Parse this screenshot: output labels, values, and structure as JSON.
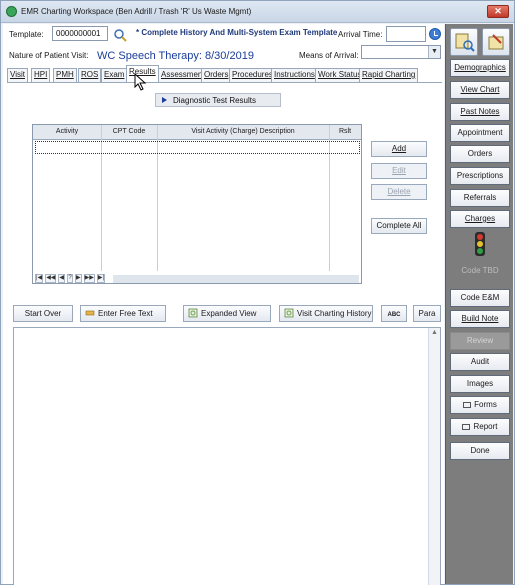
{
  "window": {
    "title": "EMR Charting Workspace (Ben Adrill / Trash 'R' Us Waste Mgmt)",
    "close_glyph": "✕"
  },
  "header": {
    "template_label": "Template:",
    "template_value": "0000000001",
    "template_name": "* Complete History And Multi-System Exam Template",
    "arrival_time_label": "Arrival Time:",
    "arrival_time_value": "",
    "nature_label": "Nature of Patient Visit:",
    "nature_value": "WC Speech Therapy: 8/30/2019",
    "means_label": "Means of Arrival:",
    "means_value": ""
  },
  "tabs": [
    {
      "label": "Visit"
    },
    {
      "label": "HPI"
    },
    {
      "label": "PMH"
    },
    {
      "label": "ROS"
    },
    {
      "label": "Exam"
    },
    {
      "label": "Results"
    },
    {
      "label": "Assessment"
    },
    {
      "label": "Orders"
    },
    {
      "label": "Procedures"
    },
    {
      "label": "Instructions"
    },
    {
      "label": "Work Status"
    },
    {
      "label": "Rapid Charting"
    }
  ],
  "active_tab": "Results",
  "diagnostic": {
    "label": "Diagnostic Test Results"
  },
  "grid": {
    "columns": [
      "Activity",
      "CPT Code",
      "Visit Activity (Charge) Description",
      "Rslt"
    ],
    "nav": [
      "|◀",
      "◀◀",
      "◀",
      "?",
      "▶",
      "▶▶",
      "▶|"
    ]
  },
  "grid_actions": {
    "add": "Add",
    "edit": "Edit",
    "delete": "Delete",
    "complete_all": "Complete All"
  },
  "toolbar": {
    "start_over": "Start Over",
    "free_text": "Enter Free Text",
    "expanded_view": "Expanded View",
    "charting_history": "Visit Charting History",
    "spell_icon_text": "ABC",
    "para": "Para"
  },
  "right_panel": {
    "demographics": "Demographics",
    "view_chart": "View Chart",
    "past_notes": "Past Notes",
    "appointment": "Appointment",
    "orders": "Orders",
    "prescriptions": "Prescriptions",
    "referrals": "Referrals",
    "charges": "Charges",
    "code_tbd": "Code TBD",
    "code_em": "Code E&M",
    "build_note": "Build Note",
    "review": "Review",
    "audit": "Audit",
    "images": "Images",
    "forms": "Forms",
    "report": "Report",
    "done": "Done"
  },
  "colors": {
    "link_blue": "#1b3d9b",
    "panel_gray": "#7d7d7d",
    "traffic_red": "#d13a2e",
    "traffic_yellow": "#e6c12f",
    "traffic_green": "#2ea043"
  }
}
